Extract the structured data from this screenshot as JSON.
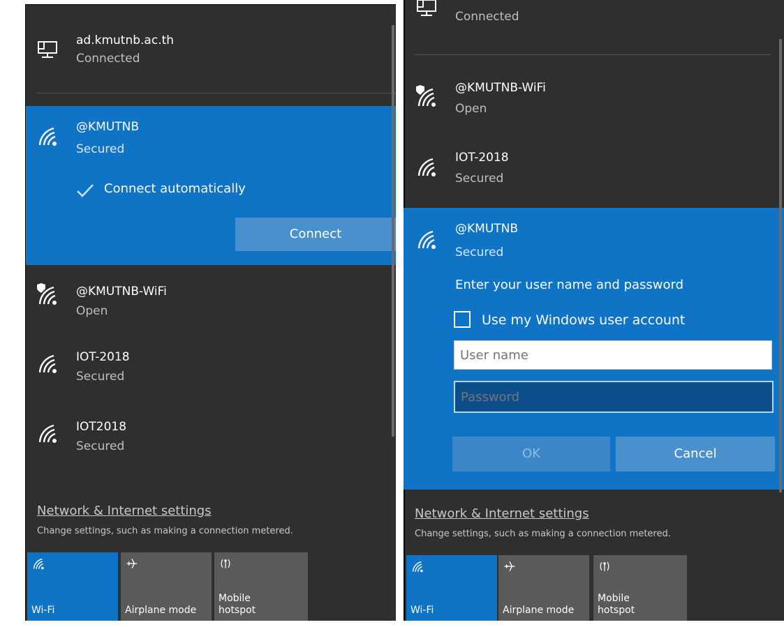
{
  "left": {
    "wired": {
      "name": "ad.kmutnb.ac.th",
      "status": "Connected"
    },
    "selected": {
      "name": "@KMUTNB",
      "status": "Secured",
      "checkbox_label": "Connect automatically",
      "connect_button": "Connect"
    },
    "networks": [
      {
        "name": "@KMUTNB-WiFi",
        "status": "Open"
      },
      {
        "name": "IOT-2018",
        "status": "Secured"
      },
      {
        "name": "IOT2018",
        "status": "Secured"
      }
    ],
    "settings_link": "Network & Internet settings",
    "settings_desc": "Change settings, such as making a connection metered.",
    "tiles": {
      "wifi": "Wi-Fi",
      "airplane": "Airplane mode",
      "hotspot_line1": "Mobile",
      "hotspot_line2": "hotspot"
    }
  },
  "right": {
    "wired_status": "Connected",
    "networks": [
      {
        "name": "@KMUTNB-WiFi",
        "status": "Open"
      },
      {
        "name": "IOT-2018",
        "status": "Secured"
      }
    ],
    "selected": {
      "name": "@KMUTNB",
      "status": "Secured",
      "prompt": "Enter your user name and password",
      "checkbox_label": "Use my Windows user account",
      "username_placeholder": "User name",
      "password_placeholder": "Password",
      "ok_button": "OK",
      "cancel_button": "Cancel"
    },
    "settings_link": "Network & Internet settings",
    "settings_desc": "Change settings, such as making a connection metered.",
    "tiles": {
      "wifi": "Wi-Fi",
      "airplane": "Airplane mode",
      "hotspot_line1": "Mobile",
      "hotspot_line2": "hotspot"
    }
  },
  "icons": [
    "monitor-icon",
    "wifi-icon",
    "shield-wifi-icon",
    "checkmark-icon",
    "airplane-icon",
    "hotspot-icon"
  ],
  "colors": {
    "panel": "#2f2f2f",
    "accent": "#0f73c6",
    "tile": "#5a5a5a"
  }
}
